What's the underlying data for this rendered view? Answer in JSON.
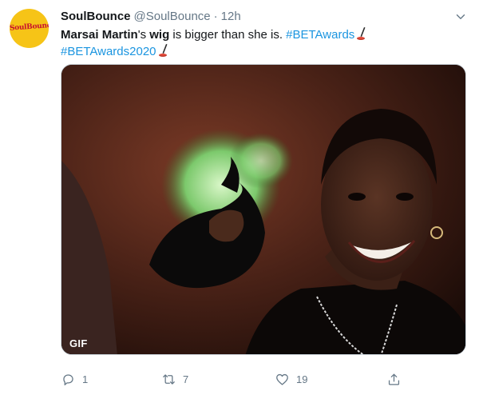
{
  "account": {
    "display_name": "SoulBounce",
    "handle": "@SoulBounce",
    "separator": "·",
    "time": "12h",
    "avatar_text": "SoulBounce"
  },
  "tweet": {
    "name_part": "Marsai Martin",
    "after_name": "'s ",
    "bold_word": "wig",
    "rest": " is bigger than she is. ",
    "hashtag1": "#BETAwards",
    "hashtag2": "#BETAwards2020"
  },
  "media": {
    "badge": "GIF"
  },
  "actions": {
    "reply_count": "1",
    "retweet_count": "7",
    "like_count": "19"
  },
  "colors": {
    "link": "#1b95e0",
    "muted": "#657786",
    "avatar_bg": "#f6c417"
  },
  "icons": {
    "caret": "chevron-down-icon",
    "reply": "reply-icon",
    "retweet": "retweet-icon",
    "like": "heart-icon",
    "share": "share-icon",
    "emoji": "award-trophy-icon"
  }
}
